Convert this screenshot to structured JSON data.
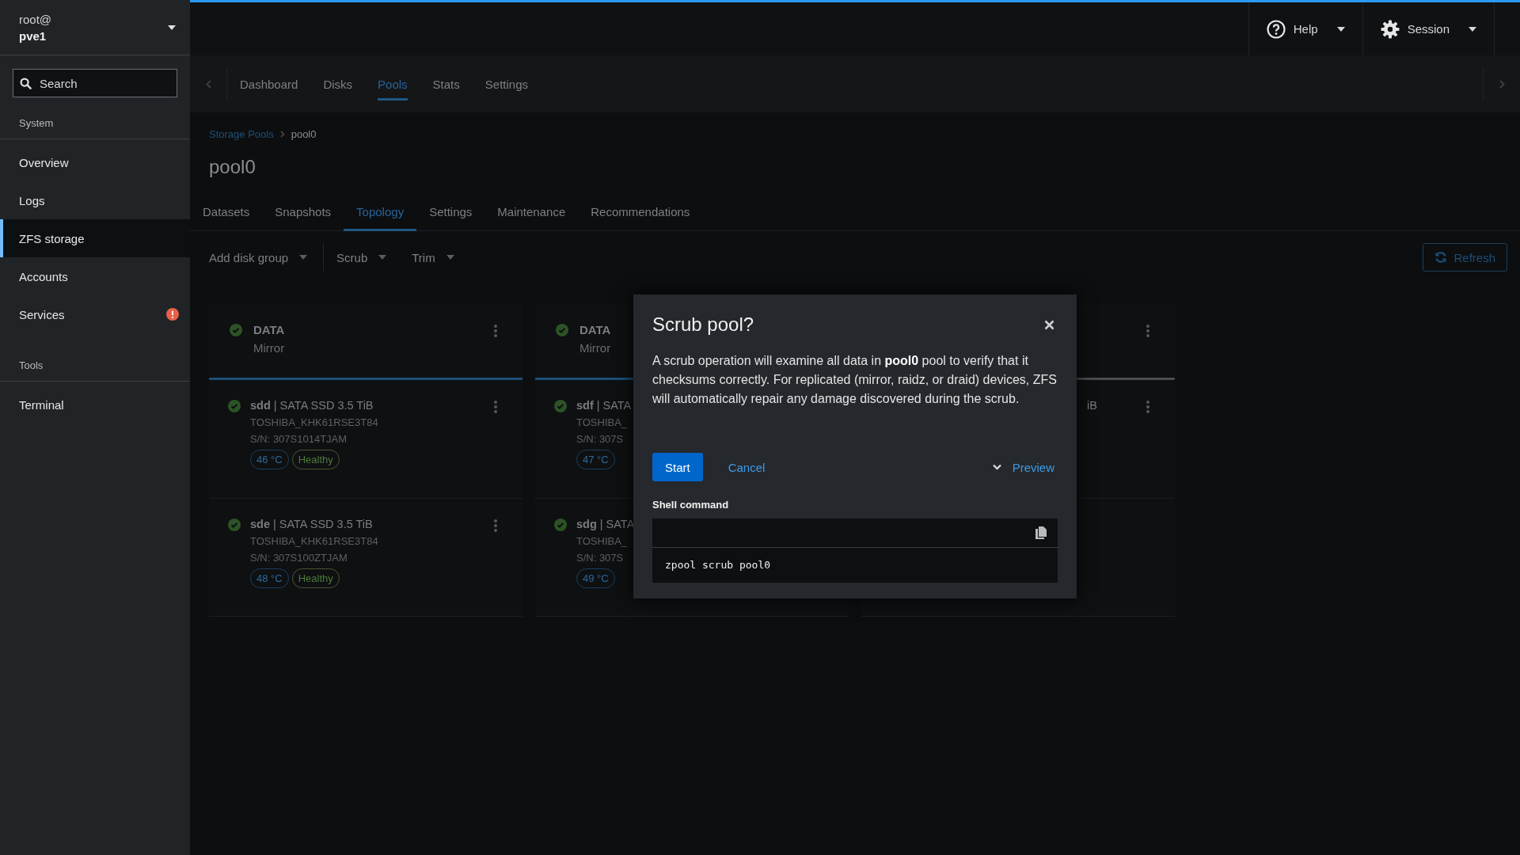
{
  "sidebar": {
    "host": {
      "user": "root@",
      "name": "pve1"
    },
    "search": {
      "placeholder": "Search"
    },
    "sections": [
      {
        "title": "System",
        "items": [
          {
            "label": "Overview",
            "selected": false,
            "alert": false
          },
          {
            "label": "Logs",
            "selected": false,
            "alert": false
          },
          {
            "label": "ZFS storage",
            "selected": true,
            "alert": false
          },
          {
            "label": "Accounts",
            "selected": false,
            "alert": false
          },
          {
            "label": "Services",
            "selected": false,
            "alert": true
          }
        ]
      },
      {
        "title": "Tools",
        "items": [
          {
            "label": "Terminal",
            "selected": false,
            "alert": false
          }
        ]
      }
    ]
  },
  "header": {
    "help": "Help",
    "session": "Session"
  },
  "nav_tabs": [
    {
      "label": "Dashboard",
      "selected": false
    },
    {
      "label": "Disks",
      "selected": false
    },
    {
      "label": "Pools",
      "selected": true
    },
    {
      "label": "Stats",
      "selected": false
    },
    {
      "label": "Settings",
      "selected": false
    }
  ],
  "breadcrumb": [
    "Storage Pools",
    "pool0"
  ],
  "title": "pool0",
  "pool_tabs": [
    {
      "label": "Datasets",
      "selected": false
    },
    {
      "label": "Snapshots",
      "selected": false
    },
    {
      "label": "Topology",
      "selected": true
    },
    {
      "label": "Settings",
      "selected": false
    },
    {
      "label": "Maintenance",
      "selected": false
    },
    {
      "label": "Recommendations",
      "selected": false
    }
  ],
  "toolbar": {
    "actions": [
      "Add disk group",
      "Scrub",
      "Trim"
    ],
    "refresh": "Refresh"
  },
  "cards": [
    {
      "title": "DATA",
      "subtitle": "Mirror",
      "highlighted": true,
      "disks": [
        {
          "label": "**sdd** | SATA SSD 3.5 TiB",
          "model": "TOSHIBA_KHK61RSE3T84",
          "serial": "S/N: 307S1014TJAM",
          "temp": "46 °C",
          "health": "Healthy",
          "menu": true
        },
        {
          "label": "**sde** | SATA SSD 3.5 TiB",
          "model": "TOSHIBA_KHK61RSE3T84",
          "serial": "S/N: 307S100ZTJAM",
          "temp": "48 °C",
          "health": "Healthy",
          "menu": true
        }
      ]
    },
    {
      "title": "DATA",
      "subtitle": "Mirror",
      "highlighted": true,
      "disks": [
        {
          "label": "**sdf** | SATA",
          "model": "TOSHIBA_",
          "serial": "S/N: 307S",
          "temp": "47 °C",
          "menu": false
        },
        {
          "label": "**sdg** | SATA",
          "model": "TOSHIBA_",
          "serial": "S/N: 307S",
          "temp": "49 °C",
          "menu": false
        }
      ]
    },
    {
      "highlighted": false,
      "disks": [
        {
          "label": "iB",
          "menu": true
        },
        {
          "menu": false
        }
      ]
    }
  ],
  "dialog": {
    "title": "Scrub pool?",
    "body": "A scrub operation will examine all data in **pool0** pool to verify that it checksums correctly. For replicated (mirror, raidz, or draid) devices, ZFS will automatically repair any damage discovered during the scrub.",
    "primary": "Start",
    "cancel": "Cancel",
    "preview": {
      "label": "Preview",
      "expanded": true
    },
    "shell_label": "Shell command",
    "command": "zpool scrub pool0"
  }
}
